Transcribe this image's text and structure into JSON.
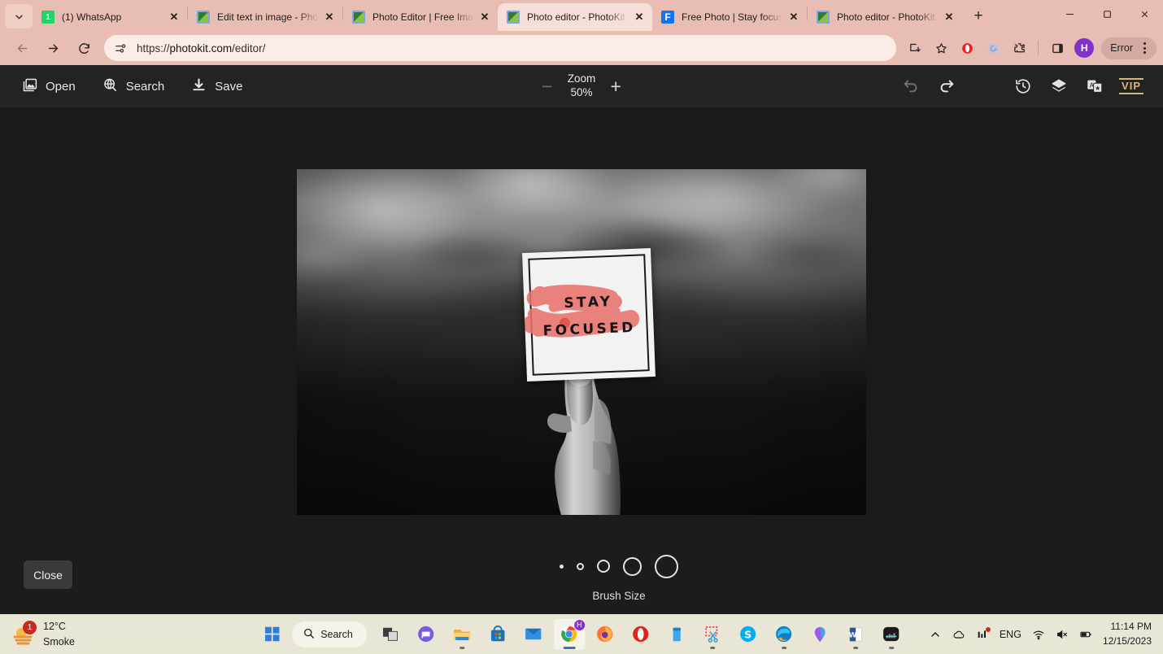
{
  "browser": {
    "tabs": [
      {
        "title": "(1) WhatsApp",
        "favicon": "whatsapp-icon",
        "active": false
      },
      {
        "title": "Edit text in image - Photo",
        "favicon": "photokit-icon",
        "active": false
      },
      {
        "title": "Photo Editor | Free Image E",
        "favicon": "photokit-icon",
        "active": false
      },
      {
        "title": "Photo editor - PhotoKit.co",
        "favicon": "photokit-icon",
        "active": true
      },
      {
        "title": "Free Photo | Stay focused t",
        "favicon": "freepik-icon",
        "active": false
      },
      {
        "title": "Photo editor - PhotoKit.co",
        "favicon": "photokit-icon",
        "active": false
      }
    ],
    "close_label": "✕",
    "newtab_label": "+",
    "window": {
      "minimize": "minimize-icon",
      "maximize": "maximize-icon",
      "close": "close-icon"
    },
    "address": {
      "url_prefix": "https://",
      "url_host": "photokit.com",
      "url_path": "/editor/",
      "site_icon": "site-settings-icon"
    },
    "nav": {
      "back": "back-arrow-icon",
      "forward": "forward-arrow-icon",
      "reload": "reload-icon"
    },
    "actions": {
      "install": "install-icon",
      "bookmark": "star-icon",
      "opera_ext": "opera-extension-icon",
      "grammarly_ext": "grammarly-extension-icon",
      "extensions": "puzzle-extensions-icon",
      "sidepanel": "side-panel-icon",
      "profile_initial": "H",
      "error_label": "Error",
      "menu": "kebab-menu-icon"
    }
  },
  "editor": {
    "tools": [
      {
        "label": "Open",
        "icon": "open-image-icon"
      },
      {
        "label": "Search",
        "icon": "search-globe-icon"
      },
      {
        "label": "Save",
        "icon": "save-download-icon"
      }
    ],
    "zoom": {
      "label": "Zoom",
      "value": "50%",
      "minus": "−",
      "plus": "+"
    },
    "right_tools": [
      {
        "name": "undo-icon",
        "dim": true
      },
      {
        "name": "redo-icon",
        "dim": false
      },
      {
        "name": "history-icon",
        "dim": false
      },
      {
        "name": "layers-icon",
        "dim": false
      },
      {
        "name": "translate-icon",
        "dim": false
      }
    ],
    "vip_label": "VIP",
    "canvas": {
      "sign_line1": "STAY",
      "sign_line2": "FOCUSED",
      "brush_color": "#e8716b",
      "description": "Blurred black and white photo of a hand holding a paper sign"
    }
  },
  "bottom": {
    "close_label": "Close",
    "brush_size_label": "Brush Size",
    "brush_sizes": [
      {
        "size": 5,
        "style": "filled",
        "selected": false
      },
      {
        "size": 9,
        "style": "ring",
        "selected": false
      },
      {
        "size": 16,
        "style": "ring",
        "selected": false
      },
      {
        "size": 23,
        "style": "ring",
        "selected": false
      },
      {
        "size": 29,
        "style": "ring",
        "selected": false
      }
    ]
  },
  "taskbar": {
    "weather": {
      "temperature": "12°C",
      "condition": "Smoke",
      "badge": "1",
      "icon": "smoke-weather-icon"
    },
    "start": "windows-start-icon",
    "search": {
      "label": "Search",
      "icon": "search-icon"
    },
    "apps": [
      {
        "name": "task-view-icon",
        "running": false
      },
      {
        "name": "chat-teams-icon",
        "running": false
      },
      {
        "name": "file-explorer-icon",
        "running": true
      },
      {
        "name": "microsoft-store-icon",
        "running": false
      },
      {
        "name": "mail-icon",
        "running": false
      },
      {
        "name": "google-chrome-icon",
        "running": true,
        "active": true,
        "badge": "H"
      },
      {
        "name": "firefox-icon",
        "running": false
      },
      {
        "name": "opera-icon",
        "running": false
      },
      {
        "name": "blue-app-icon",
        "running": false
      },
      {
        "name": "snipping-tool-icon",
        "running": true
      },
      {
        "name": "skype-icon",
        "running": false
      },
      {
        "name": "microsoft-edge-icon",
        "running": true
      },
      {
        "name": "maps-pin-icon",
        "running": false
      },
      {
        "name": "microsoft-word-icon",
        "running": true
      },
      {
        "name": "dark-app-icon",
        "running": true
      }
    ],
    "tray": {
      "chevron": "chevron-up-icon",
      "onedrive": "onedrive-cloud-icon",
      "stats": "stats-chart-icon",
      "language": "ENG",
      "wifi": "wifi-icon",
      "volume": "volume-muted-icon",
      "battery": "battery-icon",
      "time": "11:14 PM",
      "date": "12/15/2023"
    }
  }
}
